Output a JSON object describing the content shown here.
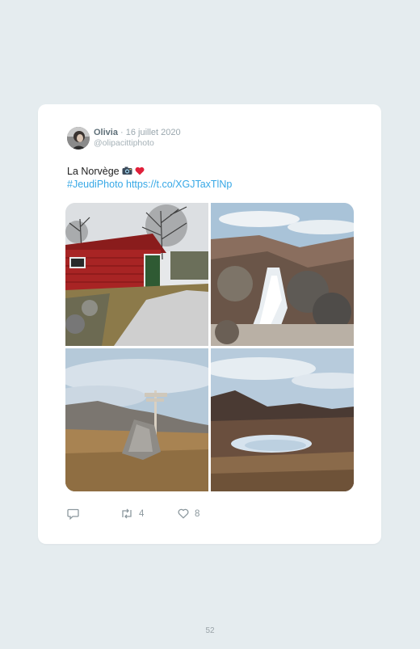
{
  "tweet": {
    "author_name": "Olivia",
    "date": "· 16 juillet 2020",
    "handle": "@olipacittiphoto",
    "text": "La Norvège",
    "hashtag": "#JeudiPhoto",
    "link": "https://t.co/XGJTaxTlNp",
    "photos": [
      {
        "subject": "red wooden cabin beside gravel path"
      },
      {
        "subject": "waterfall over rocks"
      },
      {
        "subject": "signpost on rocky hill"
      },
      {
        "subject": "lake among rocky hills"
      }
    ]
  },
  "actions": {
    "reply_icon": "reply-icon",
    "retweet_icon": "retweet-icon",
    "retweet_count": "4",
    "like_icon": "heart-icon",
    "like_count": "8"
  },
  "page_number": "52",
  "colors": {
    "link": "#37a8e6",
    "background": "#e5ecef",
    "card": "#ffffff"
  }
}
